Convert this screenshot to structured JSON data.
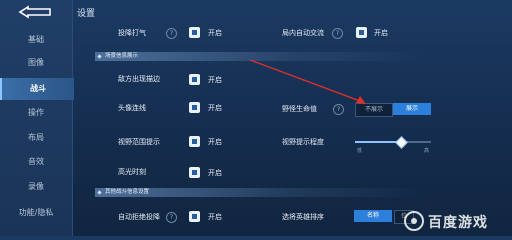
{
  "header": {
    "title": "设置"
  },
  "sidebar": {
    "items": [
      {
        "label": "基础"
      },
      {
        "label": "图像"
      },
      {
        "label": "战斗",
        "active": true
      },
      {
        "label": "操作"
      },
      {
        "label": "布局"
      },
      {
        "label": "音效"
      },
      {
        "label": "录像"
      },
      {
        "label": "功能/隐私"
      }
    ]
  },
  "sections": {
    "scene_info": "场景信息展示",
    "other_info": "其他战斗信息设置"
  },
  "settings": {
    "cast_taunt": {
      "label": "投降打气",
      "state": "开启"
    },
    "auto_chat": {
      "label": "局内自动交流",
      "state": "开启"
    },
    "enemy_edge": {
      "label": "敌方出现描边",
      "state": "开启"
    },
    "avatar_link": {
      "label": "头像连线",
      "state": "开启"
    },
    "vision_tip": {
      "label": "视野范围提示",
      "state": "开启"
    },
    "highlight": {
      "label": "高光时刻",
      "state": "开启"
    },
    "auto_reject": {
      "label": "自动拒绝投降",
      "state": "开启"
    },
    "monster_hp": {
      "label": "野怪生命值",
      "off": "不展示",
      "on": "展示"
    },
    "vision_level": {
      "label": "视野提示程度",
      "low": "低",
      "high": "高",
      "value": 0.6
    },
    "hero_sort": {
      "label": "选将英雄排序",
      "option": "名称",
      "option2": "位"
    }
  },
  "watermark": {
    "text": "百度游戏"
  },
  "colors": {
    "accent": "#2d7fdc",
    "arrow": "#e0302b"
  }
}
